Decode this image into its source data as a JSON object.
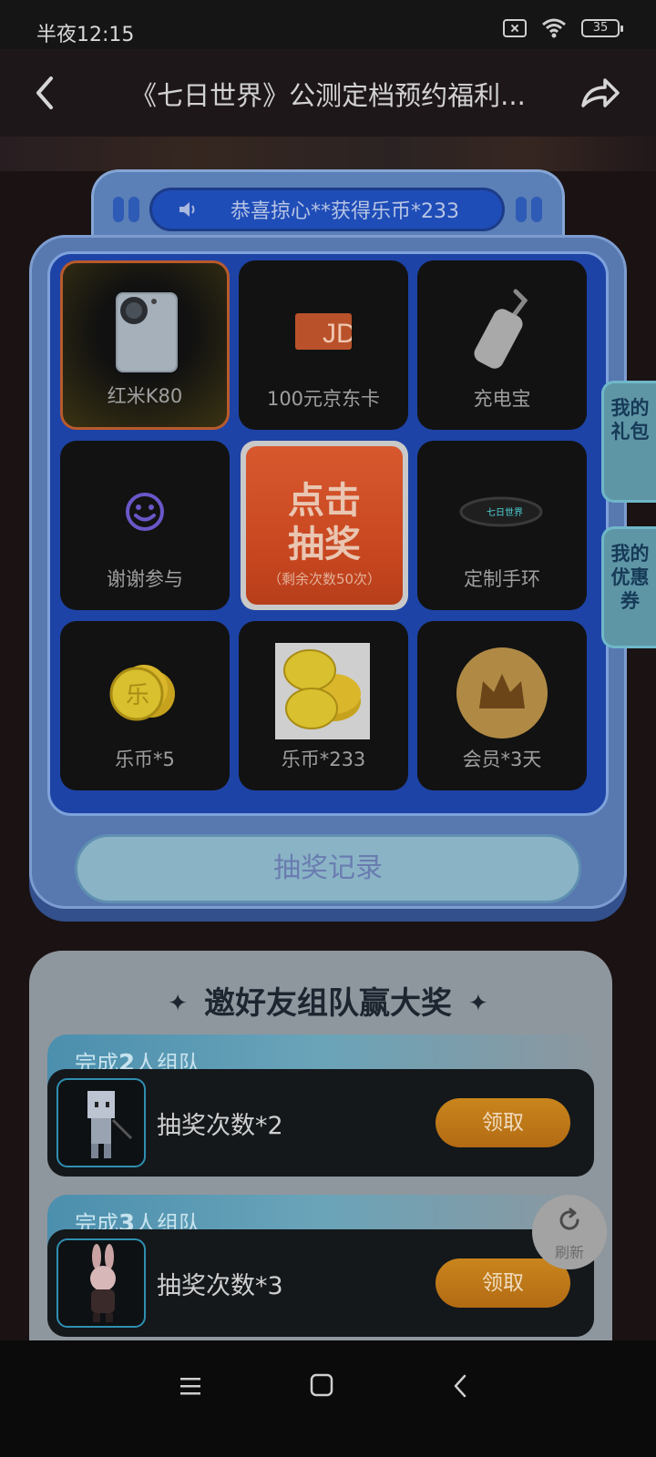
{
  "status_bar": {
    "time": "半夜12:15",
    "battery": "35"
  },
  "header": {
    "title": "《七日世界》公测定档预约福利..."
  },
  "marquee": {
    "text": "恭喜掠心**获得乐币*233"
  },
  "prizes": [
    {
      "label": "红米K80",
      "icon": "phone-icon",
      "selected": true
    },
    {
      "label": "100元京东卡",
      "icon": "jd-card-icon"
    },
    {
      "label": "充电宝",
      "icon": "power-bank-icon"
    },
    {
      "label": "谢谢参与",
      "icon": "smiley-icon"
    },
    {
      "label": "定制手环",
      "icon": "wristband-icon"
    },
    {
      "label": "乐币*5",
      "icon": "coins-icon"
    },
    {
      "label": "乐币*233",
      "icon": "coin-stack-icon"
    },
    {
      "label": "会员*3天",
      "icon": "crown-icon"
    }
  ],
  "draw_button": {
    "line1": "点击",
    "line2": "抽奖",
    "remaining": "（剩余次数50次）"
  },
  "record_button": "抽奖记录",
  "side_tabs": {
    "gift": "我的礼包",
    "coupon": "我的优惠券"
  },
  "team": {
    "title": "邀好友组队赢大奖",
    "tiers": [
      {
        "prefix": "完成",
        "count": "2",
        "suffix": "人组队",
        "reward": "抽奖次数*2",
        "button": "领取"
      },
      {
        "prefix": "完成",
        "count": "3",
        "suffix": "人组队",
        "reward": "抽奖次数*3",
        "button": "领取"
      }
    ]
  },
  "refresh": "刷新",
  "jd_card_text": "JD",
  "wristband_text": "七日世界",
  "coin_char": "乐"
}
